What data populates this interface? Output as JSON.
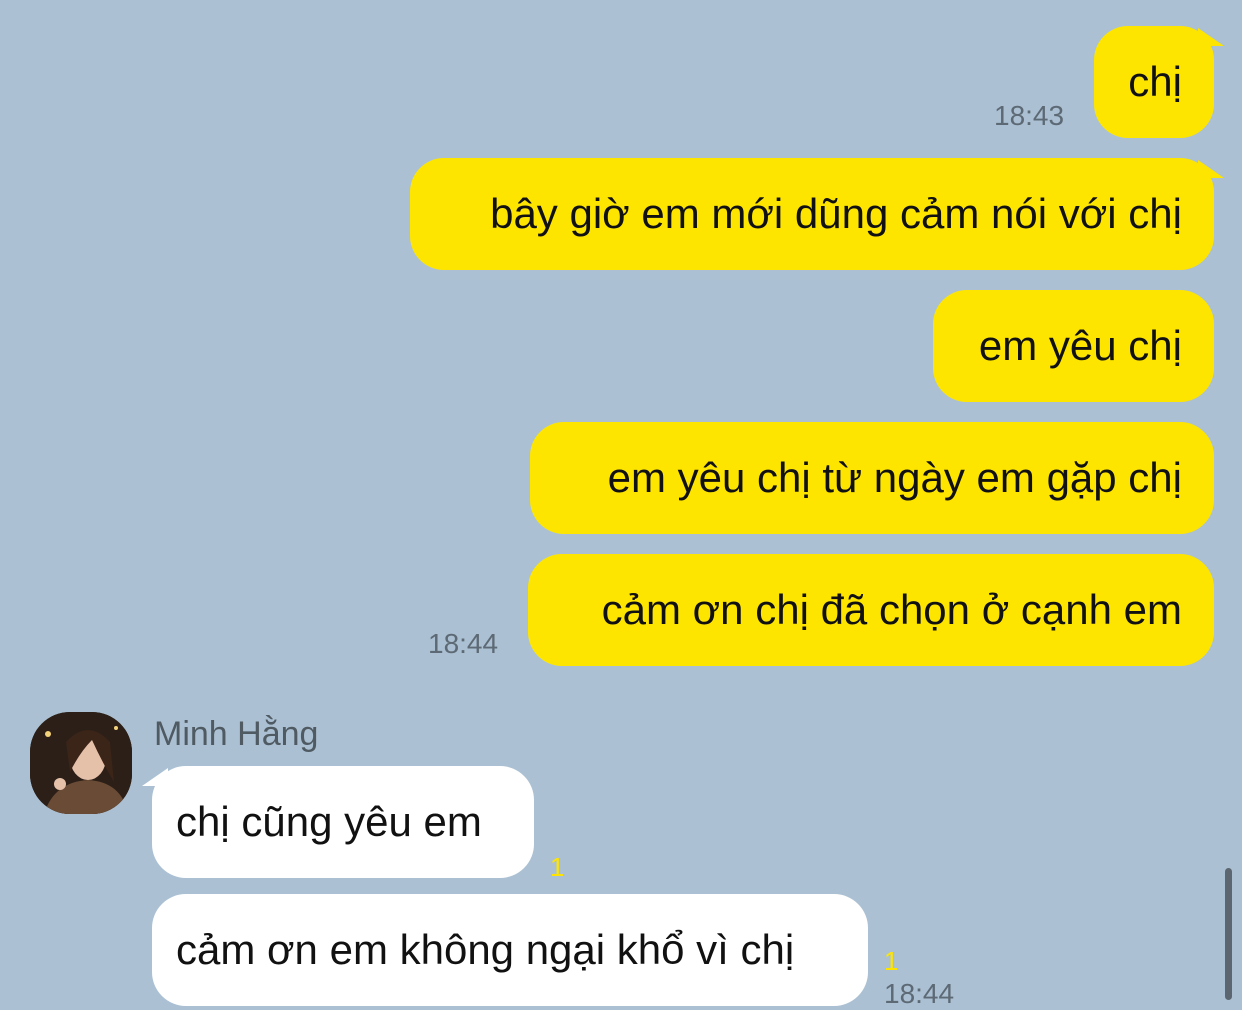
{
  "outgoing": [
    {
      "text": "chị"
    },
    {
      "text": "bây giờ em mới dũng cảm nói với chị"
    },
    {
      "text": "em yêu chị"
    },
    {
      "text": "em yêu chị từ ngày em gặp chị"
    },
    {
      "text": "cảm ơn chị đã chọn ở cạnh em"
    }
  ],
  "outgoing_times": [
    "18:43",
    "18:44"
  ],
  "incoming": {
    "sender": "Minh Hằng",
    "messages": [
      {
        "text": "chị cũng yêu em",
        "unread": "1"
      },
      {
        "text": "cảm ơn em không ngại khổ vì chị",
        "unread": "1"
      }
    ],
    "time": "18:44"
  },
  "colors": {
    "background": "#abc1d3",
    "outgoing_bubble": "#fee500",
    "incoming_bubble": "#ffffff",
    "unread_count": "#ffe400"
  },
  "icons": {
    "avatar": "profile-photo"
  }
}
